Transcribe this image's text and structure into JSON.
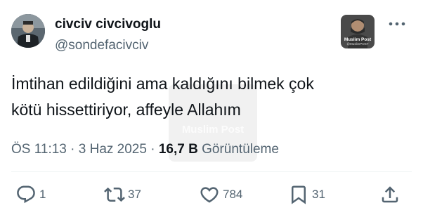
{
  "author": {
    "display_name": "civciv civcivoglu",
    "handle": "@sondefacivciv"
  },
  "badge": {
    "title": "Muslim Post",
    "subtitle": "@MuslimPOST"
  },
  "watermark": {
    "text": "Muslim Post"
  },
  "tweet": {
    "text": "İmtihan edildiğini ama kaldığını bilmek çok\nkötü hissettiriyor, affeyle Allahım"
  },
  "meta": {
    "time": "ÖS 11:13",
    "separator": "·",
    "date": "3 Haz 2025",
    "views_count": "16,7 B",
    "views_label": "Görüntüleme"
  },
  "actions": {
    "replies": "1",
    "reposts": "37",
    "likes": "784",
    "bookmarks": "31"
  },
  "icons": {
    "more": "more-horizontal-icon",
    "reply": "reply-icon",
    "repost": "repost-icon",
    "like": "heart-icon",
    "bookmark": "bookmark-icon",
    "share": "share-icon"
  },
  "colors": {
    "text_primary": "#0f1419",
    "text_secondary": "#536471",
    "divider": "#eff3f4"
  }
}
